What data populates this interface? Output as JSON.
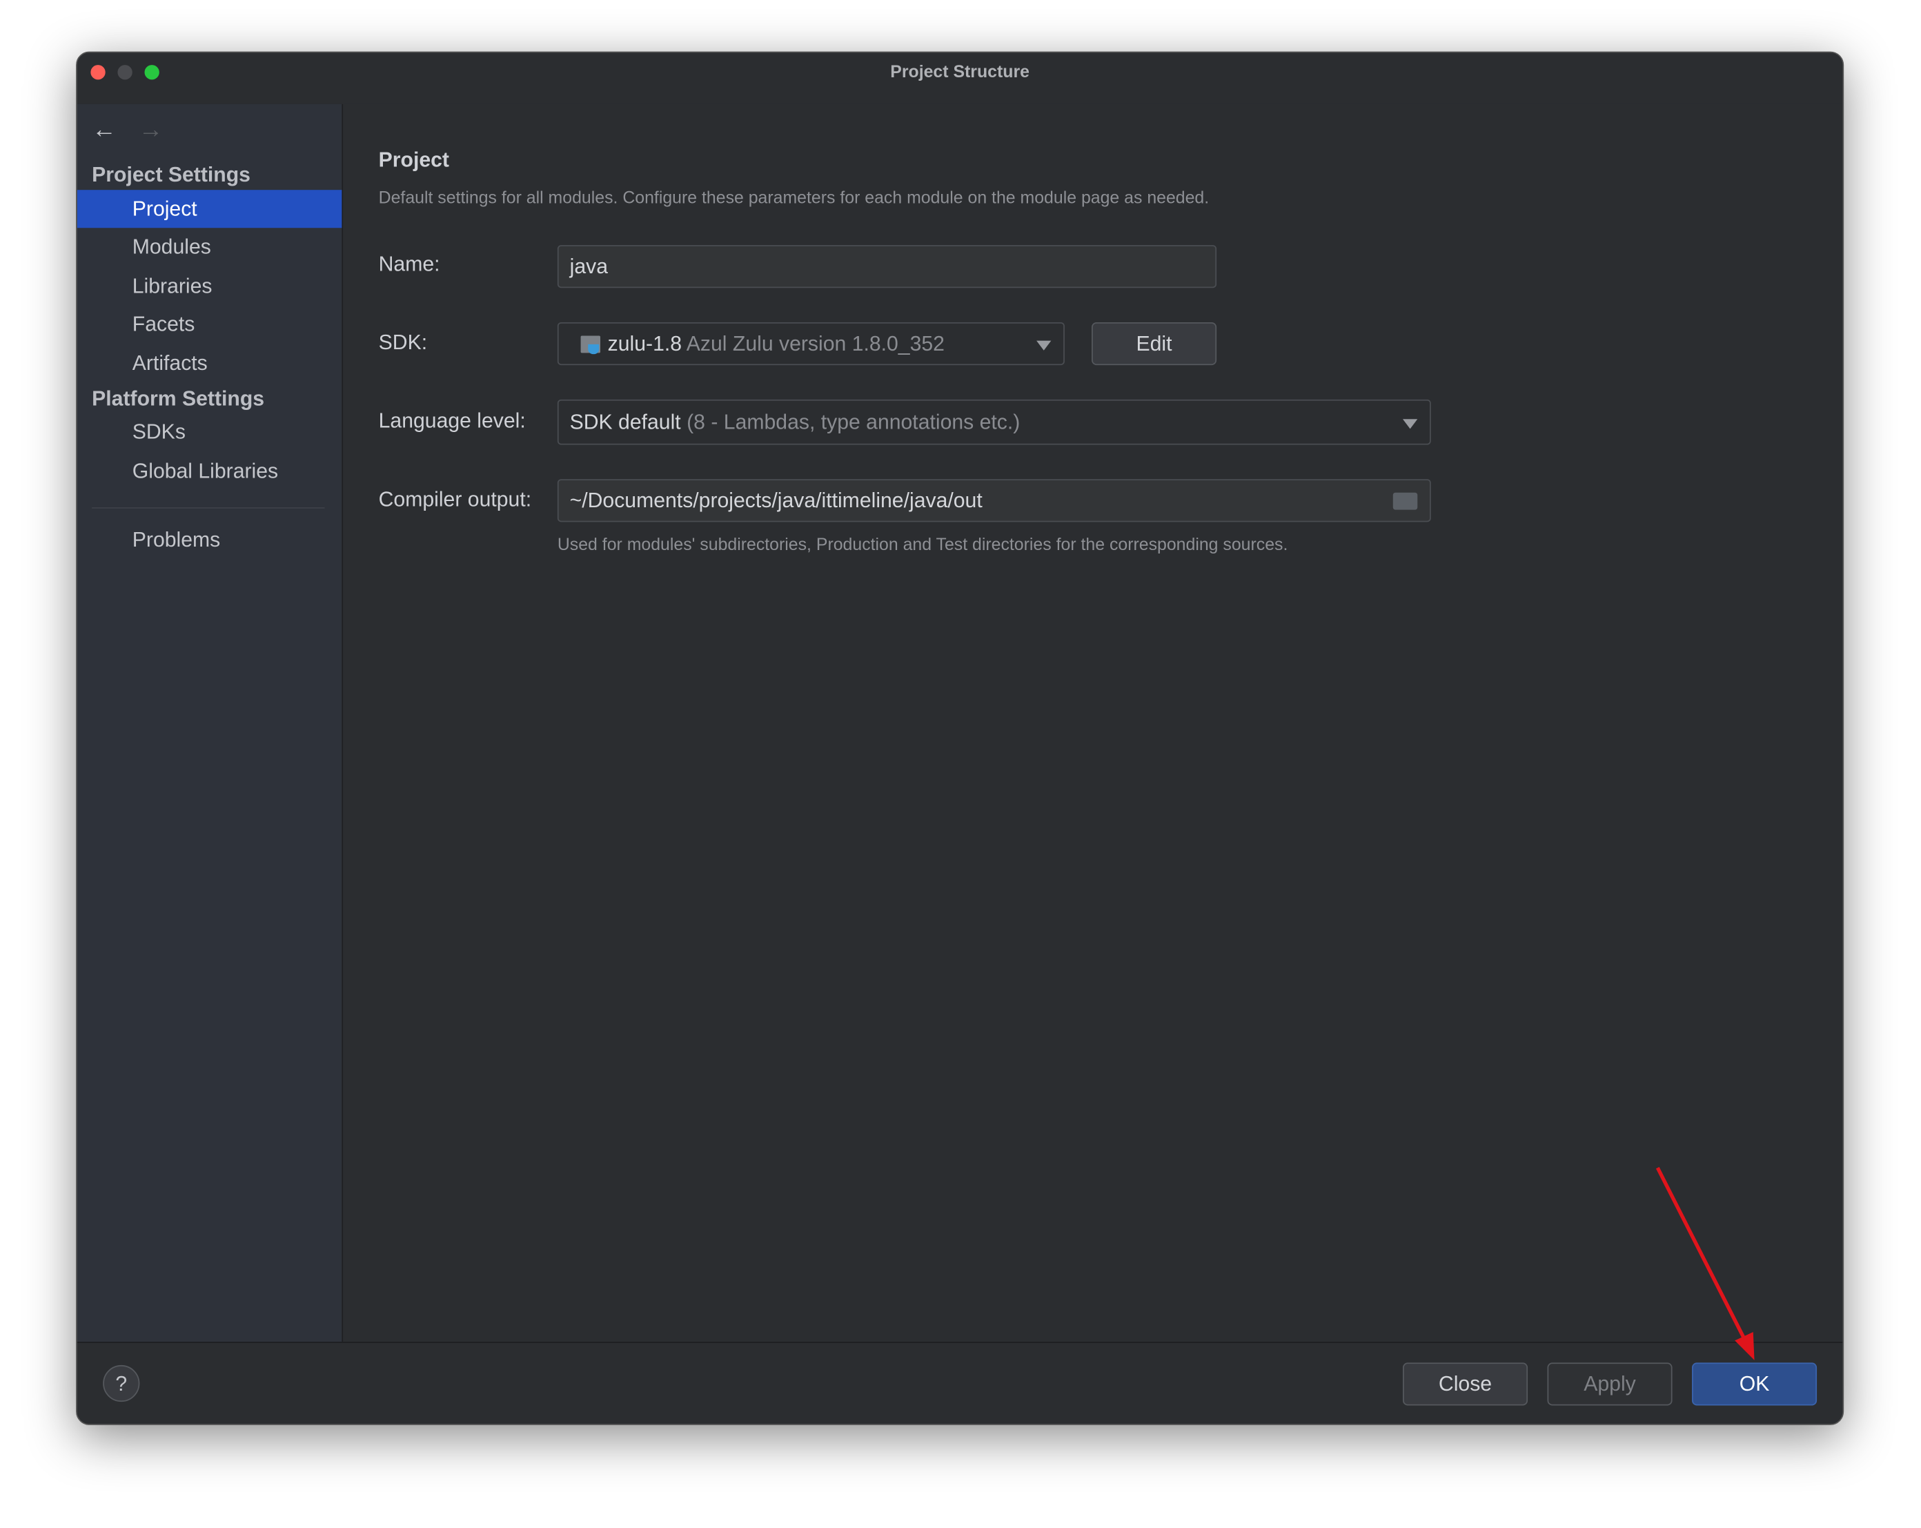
{
  "window": {
    "title": "Project Structure"
  },
  "sidebar": {
    "sections": [
      {
        "label": "Project Settings"
      },
      {
        "label": "Platform Settings"
      }
    ],
    "project_items": [
      {
        "label": "Project",
        "selected": true
      },
      {
        "label": "Modules"
      },
      {
        "label": "Libraries"
      },
      {
        "label": "Facets"
      },
      {
        "label": "Artifacts"
      }
    ],
    "platform_items": [
      {
        "label": "SDKs"
      },
      {
        "label": "Global Libraries"
      }
    ],
    "problems": "Problems"
  },
  "main": {
    "heading": "Project",
    "description": "Default settings for all modules. Configure these parameters for each module on the module page as needed.",
    "name_label": "Name:",
    "name_value": "java",
    "sdk_label": "SDK:",
    "sdk_name": "zulu-1.8",
    "sdk_version": "Azul Zulu version 1.8.0_352",
    "edit_label": "Edit",
    "language_label": "Language level:",
    "language_value": "SDK default",
    "language_detail": "(8 - Lambdas, type annotations etc.)",
    "output_label": "Compiler output:",
    "output_value": "~/Documents/projects/java/ittimeline/java/out",
    "output_hint": "Used for modules' subdirectories, Production and Test directories for the corresponding sources."
  },
  "footer": {
    "help": "?",
    "close": "Close",
    "apply": "Apply",
    "ok": "OK"
  },
  "colors": {
    "accent": "#2350c1",
    "annotation_arrow": "#e0141b"
  }
}
